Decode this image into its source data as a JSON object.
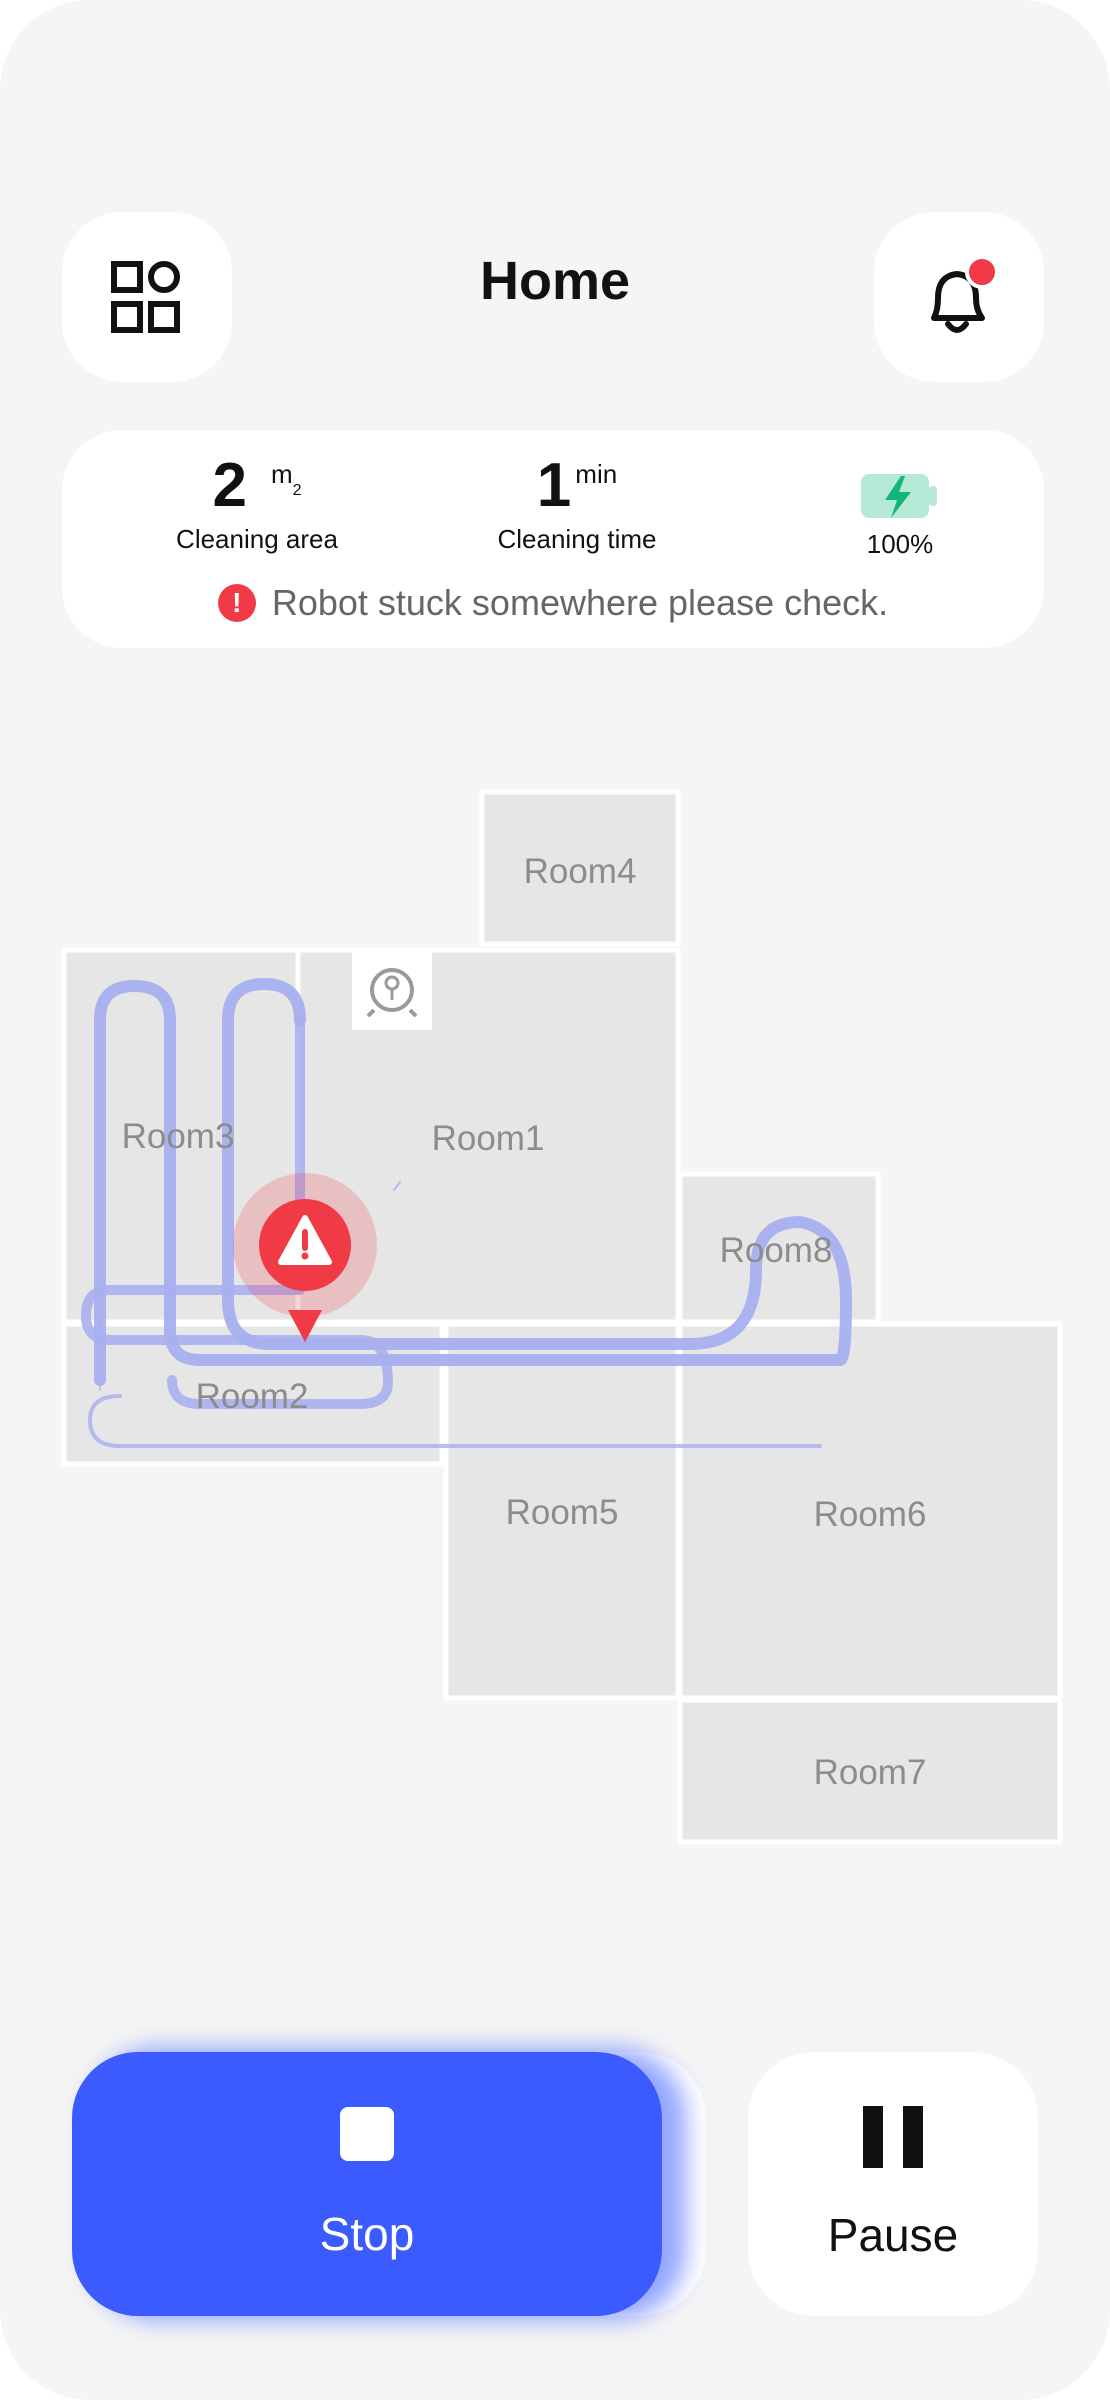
{
  "header": {
    "title": "Home",
    "menu_icon": "grid-icon",
    "notification_icon": "bell-icon",
    "notification_badge_color": "#f03a45"
  },
  "stats": {
    "area_value": "2",
    "area_unit": "m",
    "area_unit_sub": "2",
    "area_label": "Cleaning area",
    "time_value": "1",
    "time_unit": "min",
    "time_label": "Cleaning time",
    "battery_value": "100%",
    "battery_icon": "battery-charging-icon",
    "battery_level": 1.0
  },
  "alert": {
    "message": "Robot stuck somewhere please check.",
    "icon": "!",
    "color": "#f03a45"
  },
  "map": {
    "rooms": [
      {
        "name": "Room4"
      },
      {
        "name": "Room3"
      },
      {
        "name": "Room1"
      },
      {
        "name": "Room8"
      },
      {
        "name": "Room2"
      },
      {
        "name": "Room5"
      },
      {
        "name": "Room6"
      },
      {
        "name": "Room7"
      }
    ],
    "dock_icon": "robot-dock-icon",
    "warning_icon": "warning-triangle-icon",
    "path_color": "#a8aff0",
    "warning_color": "#f03a45"
  },
  "controls": {
    "stop_label": "Stop",
    "pause_label": "Pause",
    "accent": "#3b5bff"
  }
}
